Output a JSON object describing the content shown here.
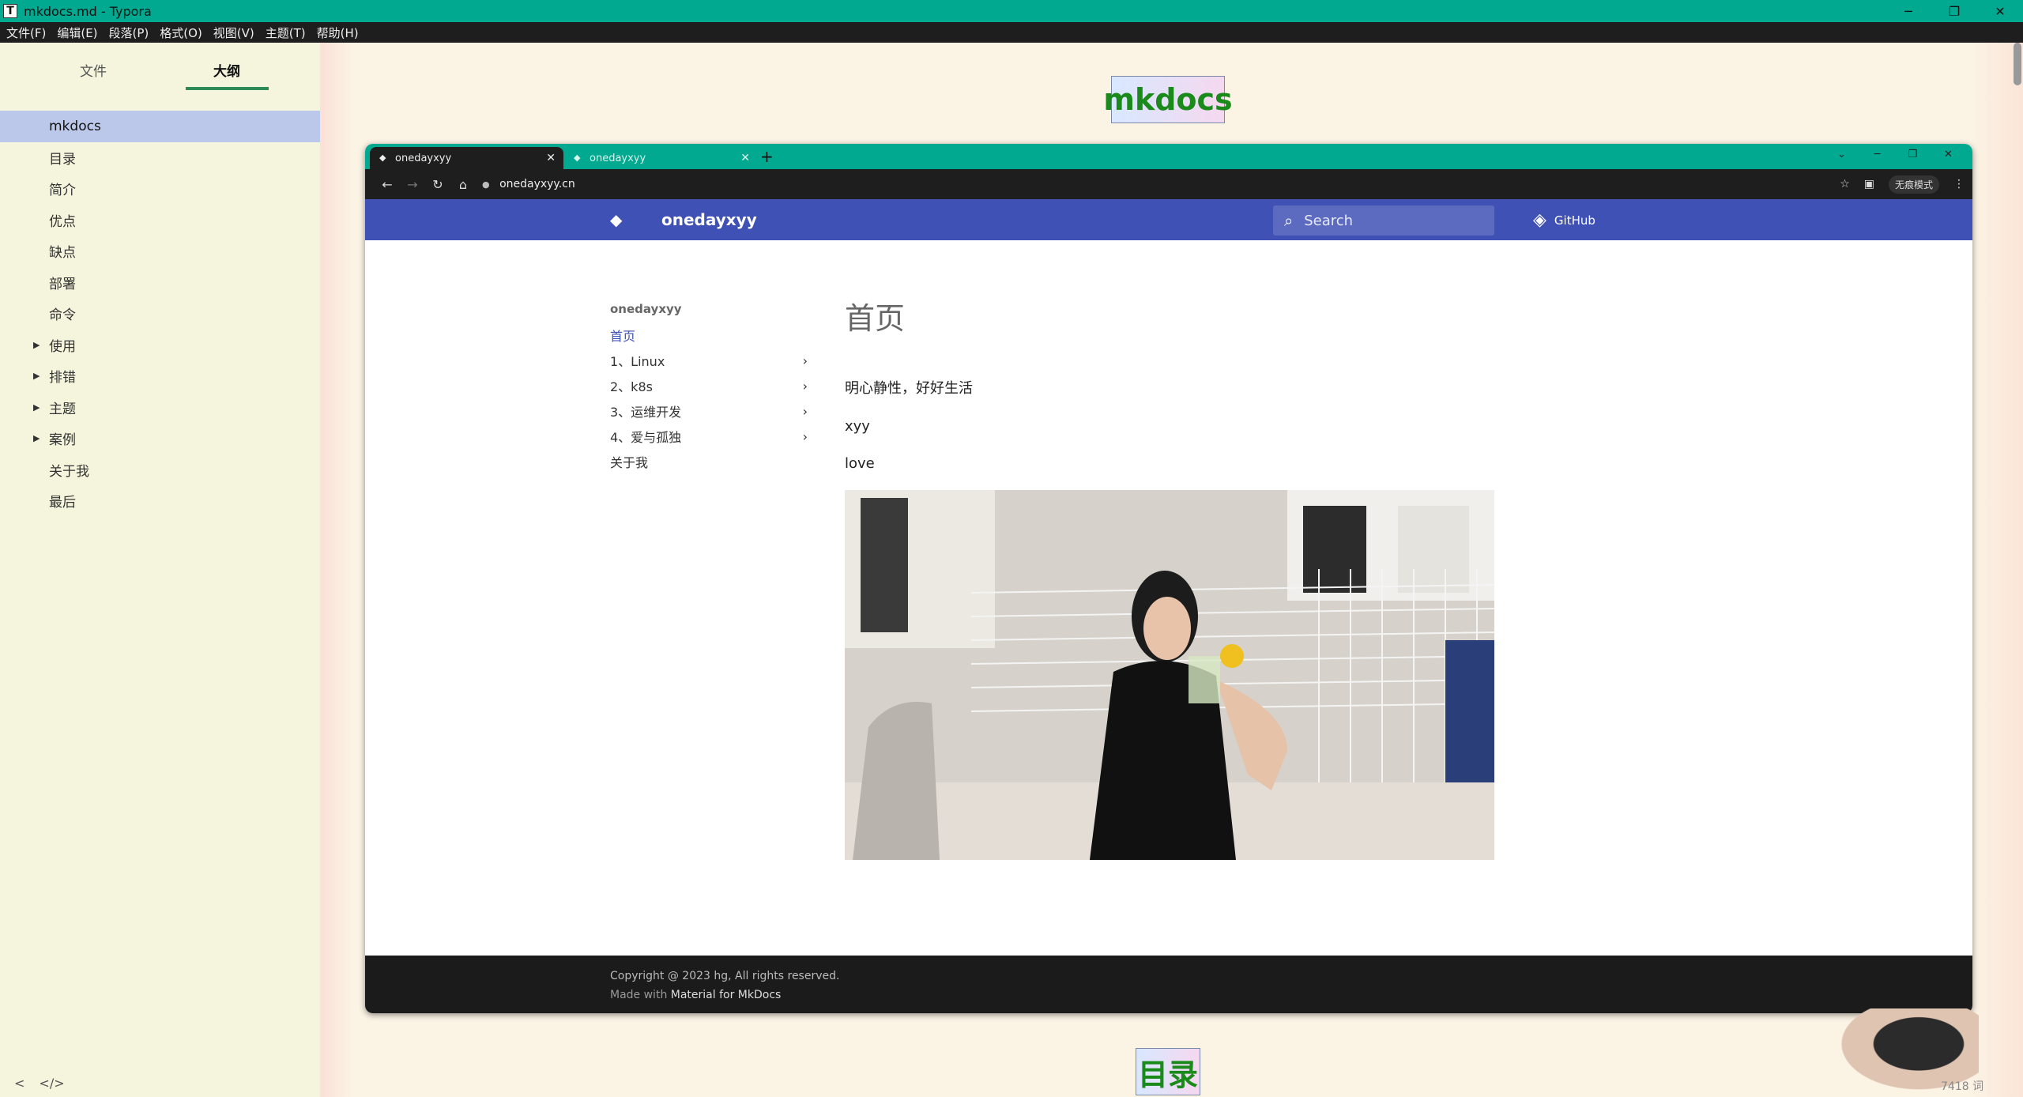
{
  "window": {
    "title": "mkdocs.md - Typora",
    "app_icon": "T",
    "controls": [
      "─",
      "❐",
      "✕"
    ]
  },
  "menubar": {
    "items": [
      "文件(F)",
      "编辑(E)",
      "段落(P)",
      "格式(O)",
      "视图(V)",
      "主题(T)",
      "帮助(H)"
    ]
  },
  "sidebar": {
    "tabs": [
      "文件",
      "大纲"
    ],
    "outline": [
      {
        "label": "mkdocs",
        "active": true,
        "collapsible": false
      },
      {
        "label": "目录",
        "collapsible": false
      },
      {
        "label": "简介",
        "collapsible": false
      },
      {
        "label": "优点",
        "collapsible": false
      },
      {
        "label": "缺点",
        "collapsible": false
      },
      {
        "label": "部署",
        "collapsible": false
      },
      {
        "label": "命令",
        "collapsible": false
      },
      {
        "label": "使用",
        "collapsible": true
      },
      {
        "label": "排错",
        "collapsible": true
      },
      {
        "label": "主题",
        "collapsible": true
      },
      {
        "label": "案例",
        "collapsible": true
      },
      {
        "label": "关于我",
        "collapsible": false
      },
      {
        "label": "最后",
        "collapsible": false
      }
    ],
    "footer": {
      "collapse": "<",
      "source": "</>"
    }
  },
  "editor": {
    "heading_top": "mkdocs",
    "heading_bottom": "目录",
    "word_count": "7418 词"
  },
  "browser": {
    "tabs": [
      {
        "label": "onedayxyy",
        "active": true
      },
      {
        "label": "onedayxyy",
        "active": false
      }
    ],
    "new_tab": "+",
    "url": "onedayxyy.cn",
    "incognito": "无痕模式",
    "site": {
      "name": "onedayxyy",
      "search_placeholder": "Search",
      "github": "GitHub",
      "nav_title": "onedayxyy",
      "nav": [
        {
          "label": "首页",
          "current": true,
          "expandable": false
        },
        {
          "label": "1、Linux",
          "expandable": true
        },
        {
          "label": "2、k8s",
          "expandable": true
        },
        {
          "label": "3、运维开发",
          "expandable": true
        },
        {
          "label": "4、爱与孤独",
          "expandable": true
        },
        {
          "label": "关于我",
          "expandable": false
        }
      ],
      "page_title": "首页",
      "paragraphs": [
        "明心静性，好好生活",
        "xyy",
        "love"
      ],
      "footer_copyright": "Copyright @ 2023 hg, All rights reserved.",
      "footer_made_prefix": "Made with ",
      "footer_made_link": "Material for MkDocs"
    }
  }
}
